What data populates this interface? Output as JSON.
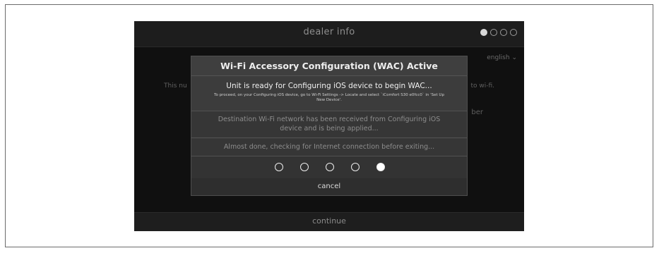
{
  "screen": {
    "title": "dealer info",
    "page_indicator": {
      "total": 4,
      "current": 1
    },
    "language": "english",
    "language_chevron_icon": "chevron-down",
    "bg_text_left": "This nu",
    "bg_text_right": "to wi-fi.",
    "bg_text_right2": "ber",
    "continue_label": "continue"
  },
  "dialog": {
    "title": "Wi-Fi Accessory Configuration (WAC) Active",
    "step1_main": "Unit is ready for Configuring iOS device to begin WAC...",
    "step1_detail": "To proceed, on your Configuring iOS device, go to Wi-Fi Settings -> Locate and select `iComfort S30 e0fcc0` in 'Set Up New Device'.",
    "step2": "Destination Wi-Fi network has been received from Configuring iOS device and is being applied...",
    "step3": "Almost done, checking for Internet connection before exiting...",
    "progress": {
      "total": 5,
      "active_index": 5
    },
    "cancel_label": "cancel"
  },
  "colors": {
    "screen_bg": "#101010",
    "dialog_bg": "#3a3a3a",
    "active_text": "#f0f0f0",
    "inactive_text": "#8d8d8d"
  }
}
